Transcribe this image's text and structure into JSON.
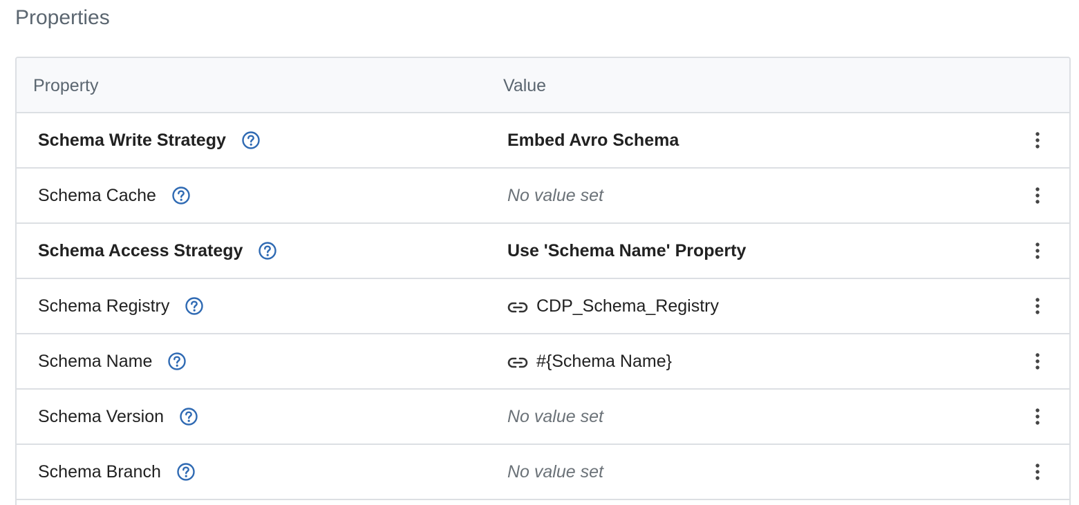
{
  "section": {
    "title": "Properties"
  },
  "table": {
    "headers": {
      "property": "Property",
      "value": "Value"
    },
    "rows": [
      {
        "name": "Schema Write Strategy",
        "value": "Embed Avro Schema",
        "name_bold": true,
        "value_style": "bold"
      },
      {
        "name": "Schema Cache",
        "value": "No value set",
        "name_bold": false,
        "value_style": "empty"
      },
      {
        "name": "Schema Access Strategy",
        "value": "Use 'Schema Name' Property",
        "name_bold": true,
        "value_style": "bold"
      },
      {
        "name": "Schema Registry",
        "value": "CDP_Schema_Registry",
        "name_bold": false,
        "value_style": "link"
      },
      {
        "name": "Schema Name",
        "value": "#{Schema Name}",
        "name_bold": false,
        "value_style": "link"
      },
      {
        "name": "Schema Version",
        "value": "No value set",
        "name_bold": false,
        "value_style": "empty"
      },
      {
        "name": "Schema Branch",
        "value": "No value set",
        "name_bold": false,
        "value_style": "empty"
      }
    ]
  },
  "icons": {
    "help": "question-circle-icon",
    "link": "link-icon",
    "menu": "more-vertical-icon"
  },
  "colors": {
    "accent": "#2f6ab3",
    "border": "#dcdfe3",
    "header_bg": "#f8f9fb",
    "muted_text": "#5b6670"
  }
}
